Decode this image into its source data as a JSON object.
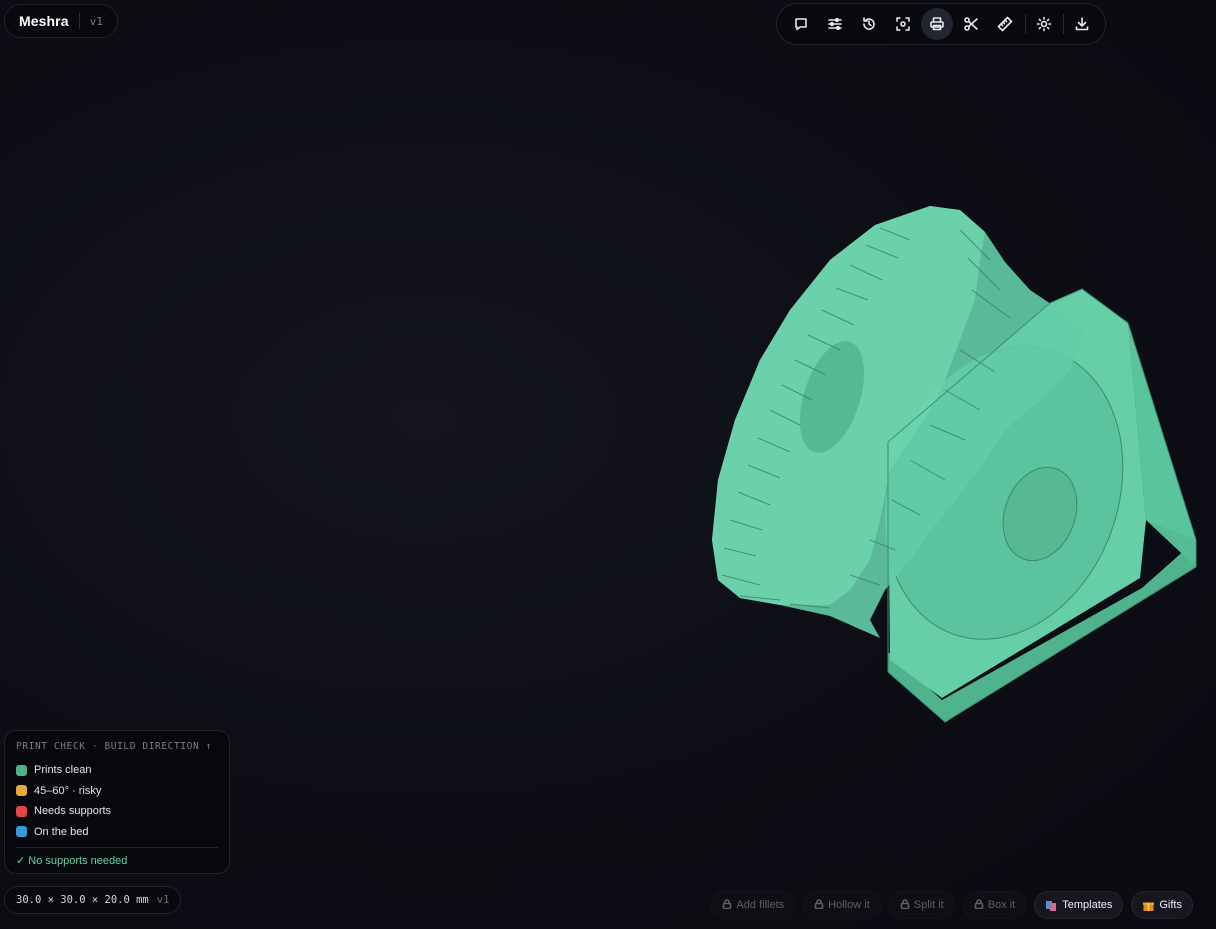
{
  "app": {
    "name": "Meshra",
    "version": "v1"
  },
  "toolbar": {
    "icons": [
      "chat-icon",
      "sliders-icon",
      "history-icon",
      "focus-icon",
      "printer-icon",
      "scissors-icon",
      "ruler-icon",
      "sun-icon",
      "download-icon"
    ],
    "active": "printer-icon"
  },
  "print_check": {
    "heading": "PRINT CHECK · BUILD DIRECTION ↑",
    "legend": [
      {
        "label": "Prints clean",
        "color": "#4fb08a"
      },
      {
        "label": "45–60° · risky",
        "color": "#e8a83a"
      },
      {
        "label": "Needs supports",
        "color": "#e04848"
      },
      {
        "label": "On the bed",
        "color": "#3a9ad9"
      }
    ],
    "status": "✓ No supports needed",
    "status_color": "#63d2a5"
  },
  "dimensions": {
    "text": "30.0 × 30.0 × 20.0 mm",
    "version": "v1"
  },
  "actions": {
    "add_fillets": "Add fillets",
    "hollow": "Hollow it",
    "split": "Split it",
    "box": "Box it",
    "templates": "Templates",
    "gifts": "Gifts"
  },
  "colors": {
    "model": "#5fc9a2",
    "background": "#0c0d14"
  }
}
